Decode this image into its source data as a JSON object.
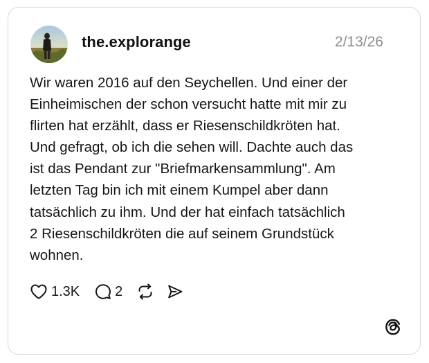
{
  "post": {
    "username": "the.explorange",
    "date": "2/13/26",
    "lines": [
      "Wir waren 2016 auf den Seychellen. Und einer der",
      "Einheimischen der schon versucht hatte mit mir zu",
      "flirten hat erzählt, dass er Riesenschildkröten hat.",
      "Und gefragt, ob ich die sehen will. Dachte auch das",
      "ist das Pendant zur \"Briefmarkensammlung\". Am",
      "letzten Tag bin ich mit einem Kumpel aber dann",
      "tatsächlich zu ihm. Und der hat einfach tatsächlich",
      "2 Riesenschildkröten die auf seinem Grundstück",
      "wohnen."
    ]
  },
  "actions": {
    "likes": "1.3K",
    "comments": "2"
  },
  "icons": {
    "like": "heart-icon",
    "comment": "comment-bubble-icon",
    "repost": "repost-icon",
    "share": "send-icon",
    "brand": "threads-logo-icon"
  },
  "colors": {
    "text": "#161616",
    "muted": "#8e8e8e",
    "border": "#d9d9d9"
  }
}
